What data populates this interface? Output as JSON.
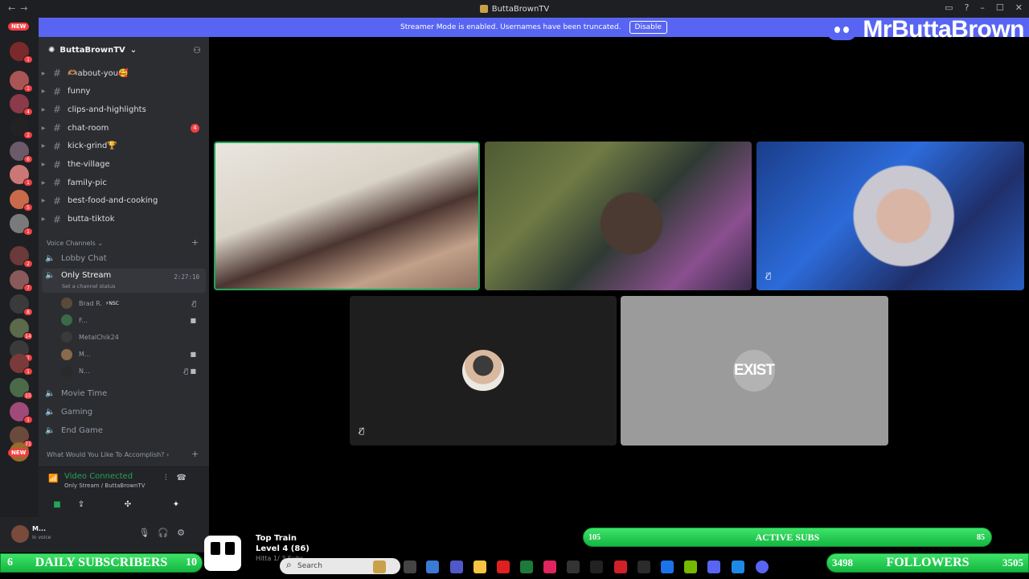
{
  "window": {
    "title": "ButtaBrownTV"
  },
  "streamer_mode": {
    "text": "Streamer Mode is enabled. Usernames have been truncated.",
    "button": "Disable"
  },
  "brand": {
    "name": "MrButtaBrown"
  },
  "rail": {
    "new_top": "NEW",
    "new_bottom": "NEW",
    "badges": [
      "1",
      "1",
      "4",
      "2",
      "6",
      "1",
      "5",
      "1",
      "2",
      "7",
      "8",
      "14",
      "2",
      "1",
      "15",
      "1",
      "21"
    ]
  },
  "server": {
    "name": "ButtaBrownTV"
  },
  "text_channels": [
    {
      "name": "🫶🏽about-you🥰",
      "ping": ""
    },
    {
      "name": "funny",
      "ping": ""
    },
    {
      "name": "clips-and-highlights",
      "ping": ""
    },
    {
      "name": "chat-room",
      "ping": "4"
    },
    {
      "name": "kick-grind🏆",
      "ping": ""
    },
    {
      "name": "the-village",
      "ping": ""
    },
    {
      "name": "family-pic",
      "ping": ""
    },
    {
      "name": "best-food-and-cooking",
      "ping": ""
    },
    {
      "name": "butta-tiktok",
      "ping": ""
    }
  ],
  "voice_category": "Voice Channels",
  "voice_channels": {
    "lobby": "Lobby Chat",
    "only_stream": "Only Stream",
    "status_hint": "Set a channel status",
    "timer": "2:27:10",
    "movie": "Movie Time",
    "gaming": "Gaming",
    "end_game": "End Game"
  },
  "voice_members": [
    {
      "name": "Brad R.",
      "tag": "⚡NSC",
      "icon": "mute-icon"
    },
    {
      "name": "F...",
      "tag": "",
      "icon": "camera-icon"
    },
    {
      "name": "MetalChik24",
      "tag": "",
      "icon": ""
    },
    {
      "name": "M...",
      "tag": "",
      "icon": "camera-icon"
    },
    {
      "name": "N...",
      "tag": "",
      "icon": "mute-camera-icons"
    }
  ],
  "accomplish_category": "What Would You Like To Accomplish?",
  "voice_status": {
    "title": "Video Connected",
    "sub": "Only Stream / ButtaBrownTV"
  },
  "user": {
    "name": "M...",
    "status": "In voice"
  },
  "overlay": {
    "active_subs_label": "ACTIVE SUBS",
    "active_subs_left": "105",
    "active_subs_right": "85",
    "daily_label": "DAILY SUBSCRIBERS",
    "daily_left": "6",
    "daily_right": "10",
    "followers_label": "FOLLOWERS",
    "followers_left": "3498",
    "followers_right": "3505",
    "train_title": "Top Train",
    "train_level": "Level 4  (86)",
    "train_sub": "Hitta 1/ 3 Subs"
  },
  "tile5_text": "EXIST",
  "taskbar": {
    "search_placeholder": "Search"
  },
  "colors": {
    "blurple": "#5865f2",
    "green": "#23a55a",
    "red": "#f23f43",
    "sidebar": "#2b2d31"
  }
}
